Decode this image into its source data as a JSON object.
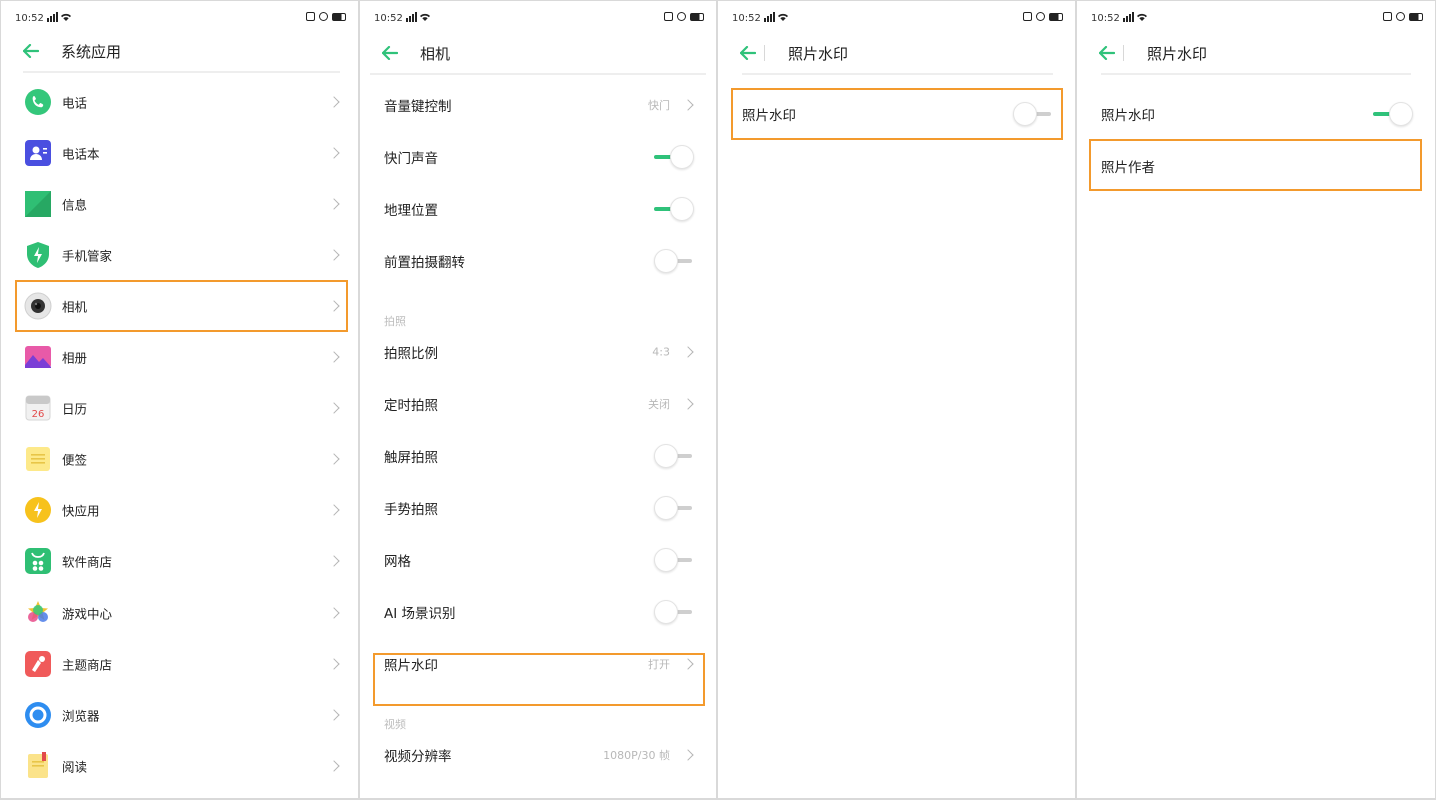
{
  "status_bar": {
    "time": "10:52",
    "signal": "?⁴ll"
  },
  "colors": {
    "accent": "#2fc27a",
    "highlight": "#f39a2d",
    "value_text": "#b8b8b8"
  },
  "panel1": {
    "title": "系统应用",
    "apps": [
      {
        "label": "电话",
        "icon": "phone-icon"
      },
      {
        "label": "电话本",
        "icon": "contacts-icon"
      },
      {
        "label": "信息",
        "icon": "messages-icon"
      },
      {
        "label": "手机管家",
        "icon": "phone-manager-icon"
      },
      {
        "label": "相机",
        "icon": "camera-icon"
      },
      {
        "label": "相册",
        "icon": "gallery-icon"
      },
      {
        "label": "日历",
        "icon": "calendar-icon",
        "icon_text": "26"
      },
      {
        "label": "便签",
        "icon": "notes-icon"
      },
      {
        "label": "快应用",
        "icon": "quick-app-icon"
      },
      {
        "label": "软件商店",
        "icon": "app-store-icon"
      },
      {
        "label": "游戏中心",
        "icon": "game-center-icon"
      },
      {
        "label": "主题商店",
        "icon": "theme-store-icon"
      },
      {
        "label": "浏览器",
        "icon": "browser-icon"
      },
      {
        "label": "阅读",
        "icon": "reader-icon"
      }
    ]
  },
  "panel2": {
    "title": "相机",
    "rows": [
      {
        "label": "音量键控制",
        "type": "value",
        "value": "快门"
      },
      {
        "label": "快门声音",
        "type": "toggle",
        "on": true
      },
      {
        "label": "地理位置",
        "type": "toggle",
        "on": true
      },
      {
        "label": "前置拍摄翻转",
        "type": "toggle",
        "on": false
      },
      {
        "label": "拍照",
        "type": "section"
      },
      {
        "label": "拍照比例",
        "type": "value",
        "value": "4:3"
      },
      {
        "label": "定时拍照",
        "type": "value",
        "value": "关闭"
      },
      {
        "label": "触屏拍照",
        "type": "toggle",
        "on": false
      },
      {
        "label": "手势拍照",
        "type": "toggle",
        "on": false
      },
      {
        "label": "网格",
        "type": "toggle",
        "on": false
      },
      {
        "label": "AI 场景识别",
        "type": "toggle",
        "on": false
      },
      {
        "label": "照片水印",
        "type": "value",
        "value": "打开"
      },
      {
        "label": "视频",
        "type": "section"
      },
      {
        "label": "视频分辨率",
        "type": "value",
        "value": "1080P/30 帧"
      }
    ]
  },
  "panel3": {
    "title": "照片水印",
    "rows": [
      {
        "label": "照片水印",
        "on": false
      }
    ]
  },
  "panel4": {
    "title": "照片水印",
    "rows": [
      {
        "label": "照片水印",
        "on": true
      },
      {
        "label": "照片作者"
      }
    ]
  }
}
